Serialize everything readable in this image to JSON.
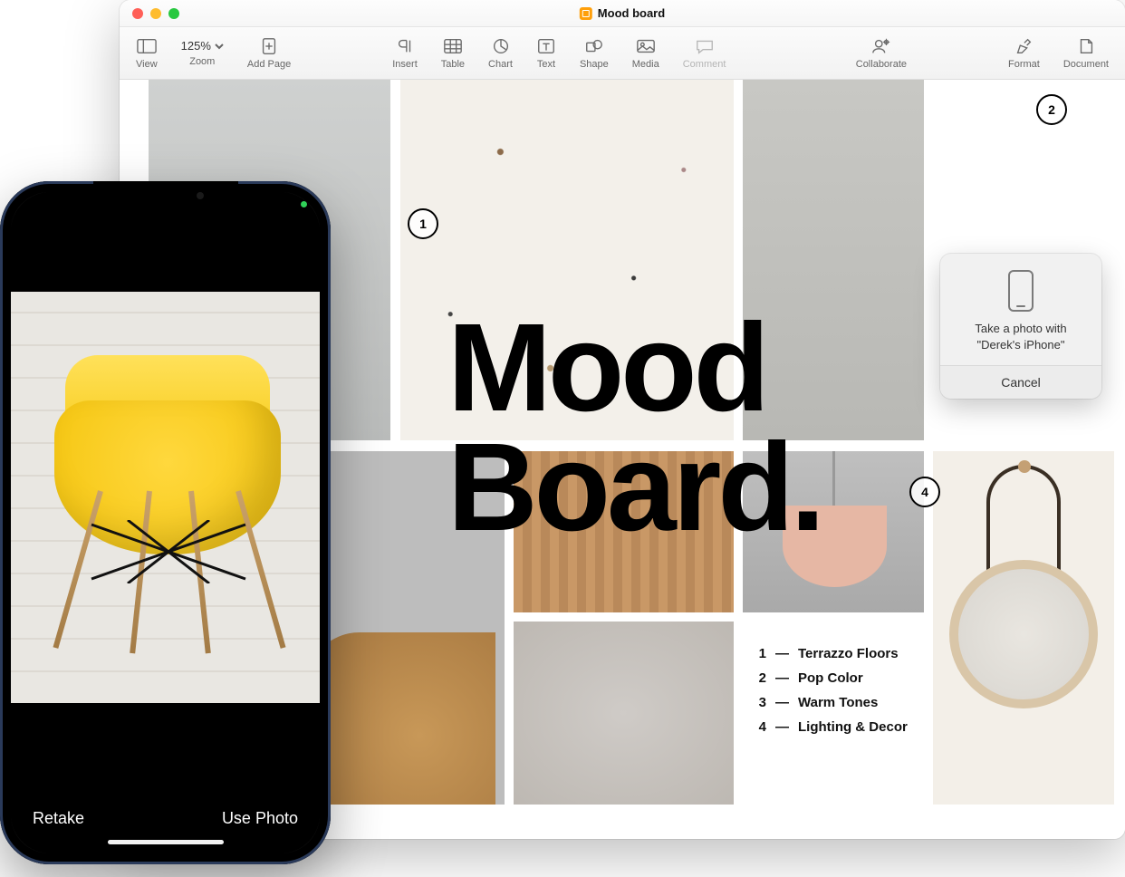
{
  "window": {
    "title": "Mood board"
  },
  "toolbar": {
    "view": "View",
    "zoom_value": "125%",
    "zoom_label": "Zoom",
    "add_page": "Add Page",
    "insert": "Insert",
    "table": "Table",
    "chart": "Chart",
    "text": "Text",
    "shape": "Shape",
    "media": "Media",
    "comment": "Comment",
    "collaborate": "Collaborate",
    "format": "Format",
    "document": "Document"
  },
  "headline": {
    "line1": "Mood",
    "line2": "Board."
  },
  "callouts": {
    "c1": "1",
    "c2": "2",
    "c4": "4"
  },
  "legend": {
    "items": [
      {
        "num": "1",
        "label": "Terrazzo Floors"
      },
      {
        "num": "2",
        "label": "Pop Color"
      },
      {
        "num": "3",
        "label": "Warm Tones"
      },
      {
        "num": "4",
        "label": "Lighting & Decor"
      }
    ]
  },
  "popover": {
    "line1": "Take a photo with",
    "line2": "\"Derek's iPhone\"",
    "cancel": "Cancel"
  },
  "iphone": {
    "retake": "Retake",
    "use_photo": "Use Photo"
  }
}
